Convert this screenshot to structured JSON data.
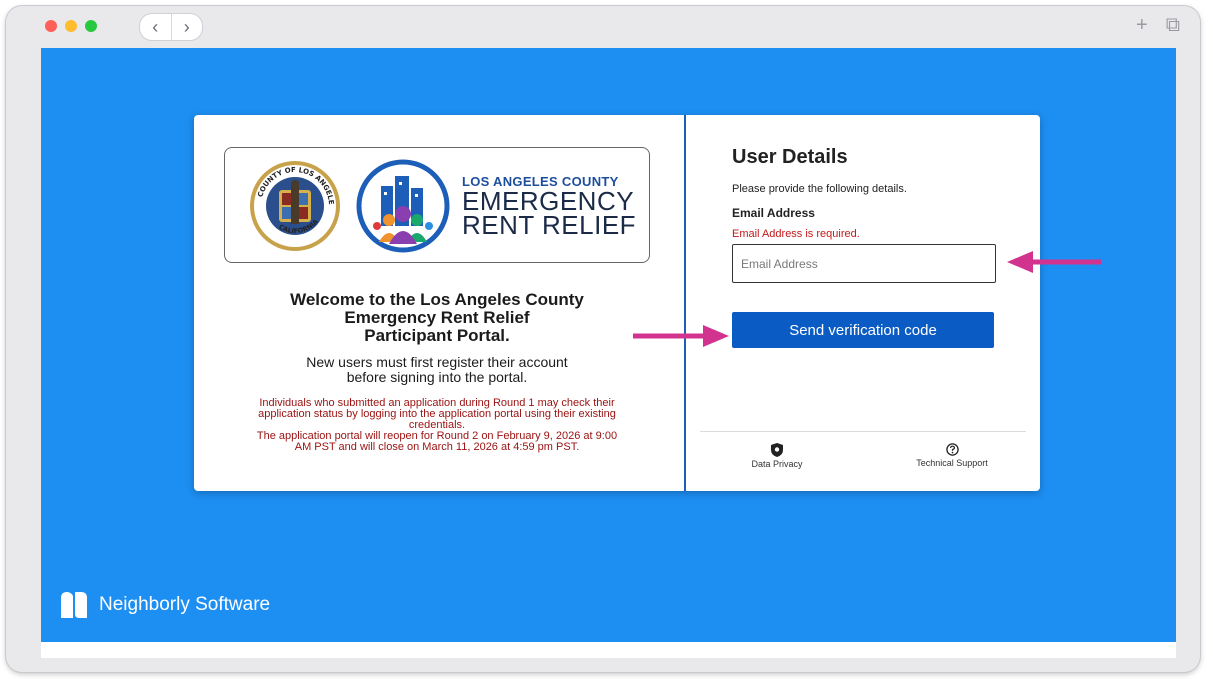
{
  "browser": {
    "back_glyph": "‹",
    "forward_glyph": "›",
    "new_tab_glyph": "+",
    "tabs_glyph": "⧉"
  },
  "logo": {
    "seal_text_top": "COUNTY OF LOS ANGELES",
    "seal_text_bottom": "CALIFORNIA",
    "line1": "LOS ANGELES COUNTY",
    "line2": "EMERGENCY",
    "line3": "RENT RELIEF"
  },
  "welcome": {
    "line1": "Welcome to the Los Angeles County",
    "line2": "Emergency Rent Relief",
    "line3": "Participant Portal.",
    "subtitle_line1": "New users must first register their account",
    "subtitle_line2": "before signing into the portal.",
    "notice_line1": "Individuals who submitted an application during Round 1 may check their",
    "notice_line2": "application status by logging into the application portal using their existing",
    "notice_line3": "credentials.",
    "notice_line4": "The application portal will reopen for Round 2 on February 9, 2026 at 9:00",
    "notice_line5": "AM PST and will close on March 11, 2026 at 4:59 pm PST."
  },
  "form": {
    "title": "User Details",
    "subtitle": "Please provide the following details.",
    "email_label": "Email Address",
    "email_error": "Email Address is required.",
    "email_placeholder": "Email Address",
    "email_value": "",
    "send_button": "Send verification code"
  },
  "footer": {
    "privacy_label": "Data Privacy",
    "support_label": "Technical Support"
  },
  "brand": {
    "name": "Neighborly Software"
  },
  "colors": {
    "page_blue": "#1d8ef2",
    "button_blue": "#0a5cc4",
    "error_red": "#c21a1a",
    "notice_red": "#9b1111",
    "arrow_magenta": "#d1338f"
  }
}
